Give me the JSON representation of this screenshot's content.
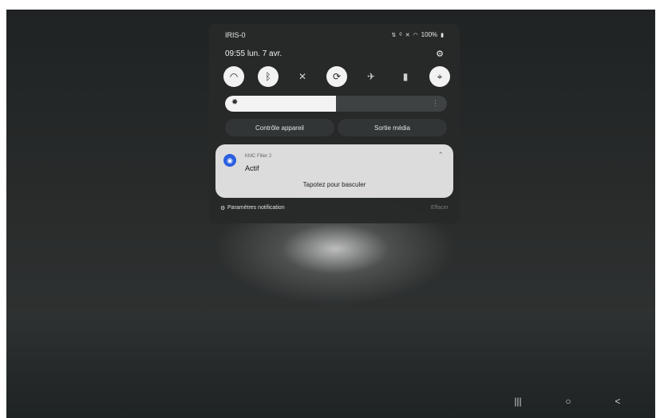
{
  "status_bar": {
    "carrier": "IRIS-0",
    "battery": "100%",
    "icons": [
      "data-icon",
      "vibrate-icon",
      "mute-icon",
      "wifi-icon",
      "battery-icon"
    ]
  },
  "header": {
    "time": "09:55",
    "date": "lun. 7 avr."
  },
  "quick_settings": {
    "tiles": [
      {
        "icon": "wifi-icon",
        "glyph": "◠",
        "state": "on"
      },
      {
        "icon": "bluetooth-icon",
        "glyph": "ᛒ",
        "state": "on"
      },
      {
        "icon": "mute-icon",
        "glyph": "✕",
        "state": "off"
      },
      {
        "icon": "auto-rotate-icon",
        "glyph": "⟳",
        "state": "on"
      },
      {
        "icon": "airplane-icon",
        "glyph": "✈",
        "state": "off"
      },
      {
        "icon": "flashlight-icon",
        "glyph": "▮",
        "state": "off"
      },
      {
        "icon": "location-icon",
        "glyph": "⌖",
        "state": "on"
      }
    ],
    "brightness_level": 0.5
  },
  "buttons": {
    "device_control": "Contrôle appareil",
    "media_output": "Sortie média"
  },
  "notification": {
    "app_name": "KMC Filter 2",
    "title": "Actif",
    "body": "Tapotez pour basculer"
  },
  "footer": {
    "settings_label": "Paramètres notification",
    "clear_label": "Effacer"
  },
  "nav_bar": {
    "recents": "|||",
    "home": "○",
    "back": "<"
  }
}
